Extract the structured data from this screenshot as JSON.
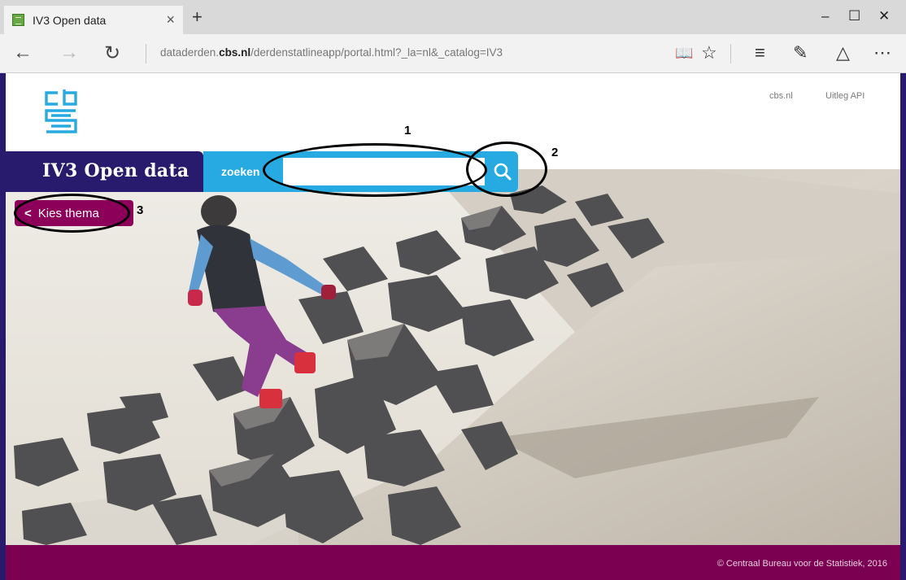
{
  "browser": {
    "tab_title": "IV3 Open data",
    "tab_close": "×",
    "new_tab": "+",
    "minimize": "–",
    "maximize": "☐",
    "close": "✕",
    "url_domain_prefix": "dataderden.",
    "url_domain_bold": "cbs.nl",
    "url_path": "/derdenstatlineapp/portal.html?_la=nl&_catalog=IV3"
  },
  "header": {
    "links": [
      "cbs.nl",
      "Uitleg API"
    ]
  },
  "brand": {
    "title": "IV3 Open data"
  },
  "search": {
    "label": "zoeken",
    "placeholder": "",
    "value": ""
  },
  "theme_button": {
    "label": "Kies thema"
  },
  "annotations": [
    "1",
    "2",
    "3"
  ],
  "footer": {
    "copyright": "© Centraal Bureau voor de Statistiek, 2016"
  },
  "colors": {
    "brand_navy": "#281b6e",
    "search_blue": "#27aae1",
    "theme_purple": "#8c005a",
    "footer_purple": "#7b0052"
  }
}
